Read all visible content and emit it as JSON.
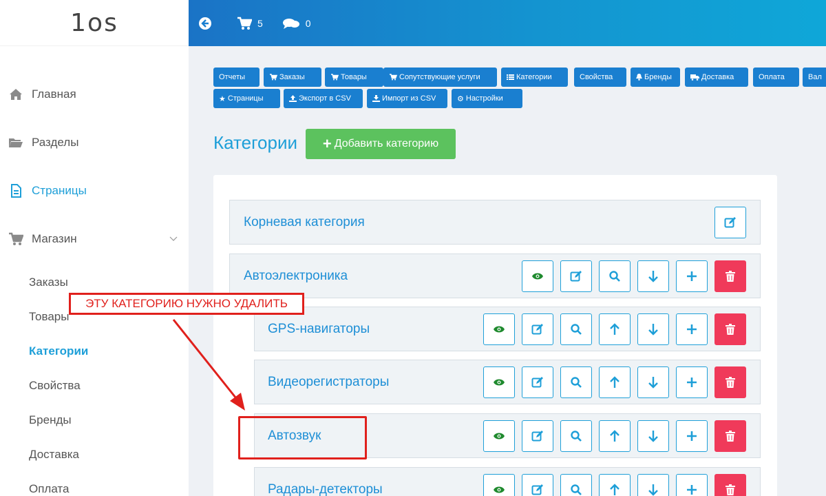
{
  "logo": {
    "text": "1os"
  },
  "topbar": {
    "cart_count": "5",
    "messages_count": "0"
  },
  "sidebar": {
    "items": [
      {
        "label": "Главная",
        "icon": "home-icon"
      },
      {
        "label": "Разделы",
        "icon": "folder-icon"
      },
      {
        "label": "Страницы",
        "icon": "file-icon"
      },
      {
        "label": "Магазин",
        "icon": "cart-icon"
      }
    ],
    "sub_items": [
      {
        "label": "Заказы"
      },
      {
        "label": "Товары"
      },
      {
        "label": "Категории"
      },
      {
        "label": "Свойства"
      },
      {
        "label": "Бренды"
      },
      {
        "label": "Доставка"
      },
      {
        "label": "Оплата"
      }
    ]
  },
  "toolbar": {
    "buttons": [
      {
        "label": "Отчеты"
      },
      {
        "label": "Заказы"
      },
      {
        "label": "Товары"
      },
      {
        "label": "Сопутствующие услуги"
      },
      {
        "label": "Категории"
      },
      {
        "label": "Свойства"
      },
      {
        "label": "Бренды"
      },
      {
        "label": "Доставка"
      },
      {
        "label": "Оплата"
      },
      {
        "label": "Вал"
      },
      {
        "label": "Страницы"
      },
      {
        "label": "Экспорт в CSV"
      },
      {
        "label": "Импорт из CSV"
      },
      {
        "label": "Настройки"
      }
    ]
  },
  "page": {
    "title": "Категории",
    "add_button": "Добавить категорию"
  },
  "categories": [
    {
      "name": "Корневая категория"
    },
    {
      "name": "Автоэлектроника"
    },
    {
      "name": "GPS-навигаторы"
    },
    {
      "name": "Видеорегистраторы"
    },
    {
      "name": "Автозвук"
    },
    {
      "name": "Радары-детекторы"
    }
  ],
  "annotation": {
    "label": "ЭТУ КАТЕГОРИЮ НУЖНО УДАЛИТЬ"
  },
  "colors": {
    "accent": "#1e9fd8",
    "button_blue": "#1a7fd0",
    "add_green": "#5cc25e",
    "delete_red": "#f03a5a",
    "eye_green": "#1f8a2e",
    "annotation_red": "#e0201c"
  }
}
